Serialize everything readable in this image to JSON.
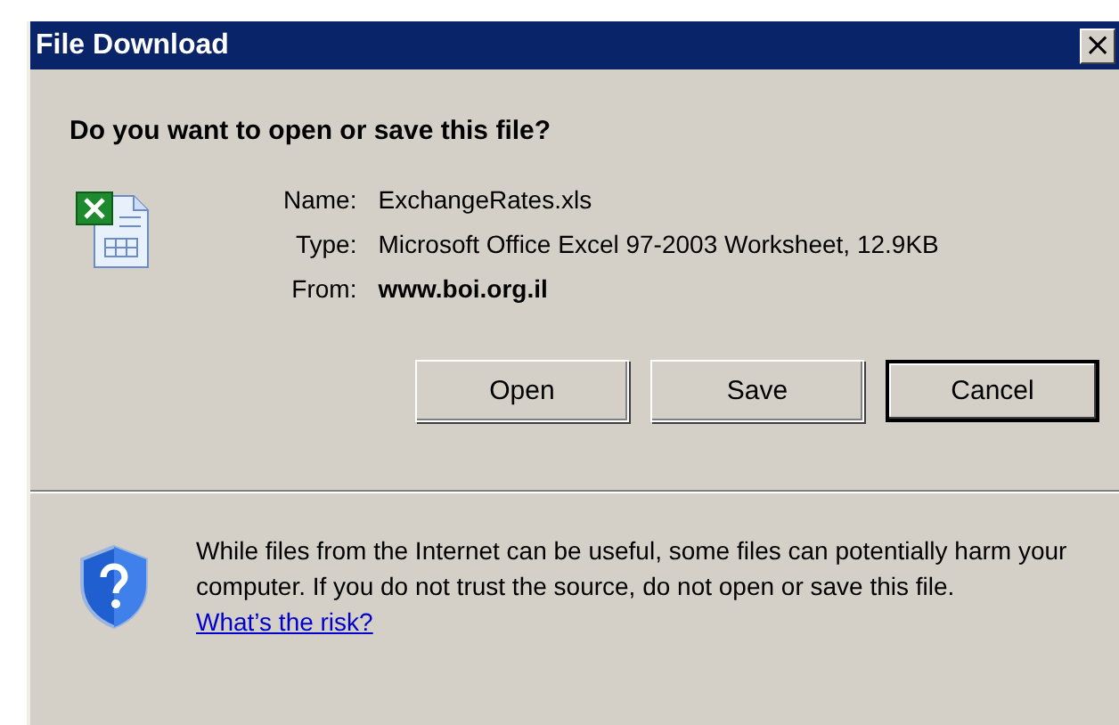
{
  "window": {
    "title": "File Download",
    "close_label": "×"
  },
  "heading": "Do you want to open or save this file?",
  "details": [
    {
      "label": "Name:",
      "value": "ExchangeRates.xls",
      "bold": false
    },
    {
      "label": "Type:",
      "value": "Microsoft Office Excel 97-2003 Worksheet, 12.9KB",
      "bold": false
    },
    {
      "label": "From:",
      "value": "www.boi.org.il",
      "bold": true
    }
  ],
  "buttons": [
    {
      "label": "Open",
      "default": false
    },
    {
      "label": "Save",
      "default": false
    },
    {
      "label": "Cancel",
      "default": true
    }
  ],
  "warning": {
    "text": "While files from the Internet can be useful, some files can potentially harm your computer. If you do not trust the source, do not open or save this file.",
    "link": "What’s the risk?"
  }
}
